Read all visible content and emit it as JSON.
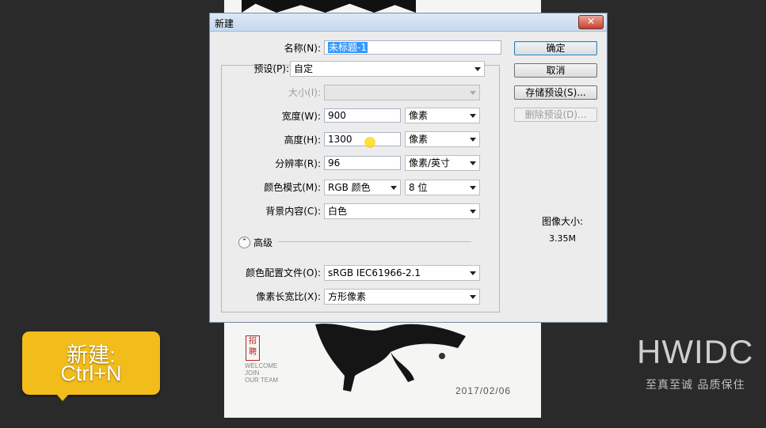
{
  "poster": {
    "seal_text": "招聘",
    "caption_lines": [
      "WELCOME",
      "JOIN",
      "OUR TEAM"
    ],
    "date": "2017/02/06"
  },
  "callout": {
    "line1": "新建:",
    "line2": "Ctrl+N"
  },
  "watermark": {
    "logo": "HWIDC",
    "slogan": "至真至诚 品质保住"
  },
  "dialog": {
    "title": "新建",
    "close_label": "✕",
    "fields": {
      "name": {
        "label": "名称(N):",
        "value": "未标题-1"
      },
      "preset": {
        "label": "预设(P):",
        "value": "自定"
      },
      "size": {
        "label": "大小(I):",
        "value": ""
      },
      "width": {
        "label": "宽度(W):",
        "value": "900",
        "unit": "像素"
      },
      "height": {
        "label": "高度(H):",
        "value": "1300",
        "unit": "像素"
      },
      "resolution": {
        "label": "分辨率(R):",
        "value": "96",
        "unit": "像素/英寸"
      },
      "color_mode": {
        "label": "颜色模式(M):",
        "value": "RGB 颜色",
        "depth": "8 位"
      },
      "background": {
        "label": "背景内容(C):",
        "value": "白色"
      },
      "advanced": {
        "label": "高级"
      },
      "color_profile": {
        "label": "颜色配置文件(O):",
        "value": "sRGB IEC61966-2.1"
      },
      "pixel_aspect": {
        "label": "像素长宽比(X):",
        "value": "方形像素"
      }
    },
    "buttons": {
      "ok": "确定",
      "cancel": "取消",
      "save_preset": "存储预设(S)...",
      "delete_preset": "删除预设(D)..."
    },
    "image_size": {
      "label": "图像大小:",
      "value": "3.35M"
    }
  }
}
